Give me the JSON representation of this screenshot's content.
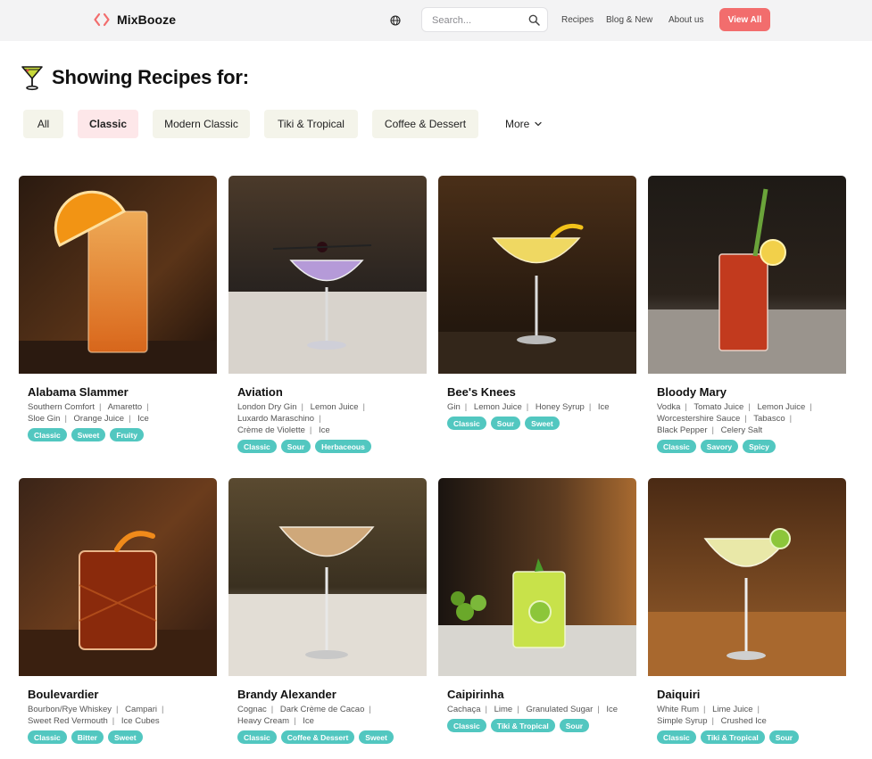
{
  "header": {
    "brand": "MixBooze",
    "search_placeholder": "Search...",
    "nav": [
      "Recipes",
      "Blog & New",
      "About us"
    ],
    "cta": "View All",
    "accent_color": "#f26d6d"
  },
  "page_title": "Showing Recipes for:",
  "filters": [
    {
      "label": "All",
      "active": false
    },
    {
      "label": "Classic",
      "active": true
    },
    {
      "label": "Modern Classic",
      "active": false
    },
    {
      "label": "Tiki & Tropical",
      "active": false
    },
    {
      "label": "Coffee & Dessert",
      "active": false
    }
  ],
  "more_label": "More",
  "tag_color": "#52c7c0",
  "recipes": [
    {
      "name": "Alabama Slammer",
      "ingredients": [
        "Southern Comfort",
        "Amaretto",
        "Sloe Gin",
        "Orange Juice",
        "Ice"
      ],
      "tags": [
        "Classic",
        "Sweet",
        "Fruity"
      ]
    },
    {
      "name": "Aviation",
      "ingredients": [
        "London Dry Gin",
        "Lemon Juice",
        "Luxardo Maraschino",
        "Crème de Violette",
        "Ice"
      ],
      "tags": [
        "Classic",
        "Sour",
        "Herbaceous"
      ]
    },
    {
      "name": "Bee's Knees",
      "ingredients": [
        "Gin",
        "Lemon Juice",
        "Honey Syrup",
        "Ice"
      ],
      "tags": [
        "Classic",
        "Sour",
        "Sweet"
      ]
    },
    {
      "name": "Bloody Mary",
      "ingredients": [
        "Vodka",
        "Tomato Juice",
        "Lemon Juice",
        "Worcestershire Sauce",
        "Tabasco",
        "Black Pepper",
        "Celery Salt"
      ],
      "tags": [
        "Classic",
        "Savory",
        "Spicy"
      ]
    },
    {
      "name": "Boulevardier",
      "ingredients": [
        "Bourbon/Rye Whiskey",
        "Campari",
        "Sweet Red Vermouth",
        "Ice Cubes"
      ],
      "tags": [
        "Classic",
        "Bitter",
        "Sweet"
      ]
    },
    {
      "name": "Brandy Alexander",
      "ingredients": [
        "Cognac",
        "Dark Crème de Cacao",
        "Heavy Cream",
        "Ice"
      ],
      "tags": [
        "Classic",
        "Coffee & Dessert",
        "Sweet"
      ]
    },
    {
      "name": "Caipirinha",
      "ingredients": [
        "Cachaça",
        "Lime",
        "Granulated Sugar",
        "Ice"
      ],
      "tags": [
        "Classic",
        "Tiki & Tropical",
        "Sour"
      ]
    },
    {
      "name": "Daiquiri",
      "ingredients": [
        "White Rum",
        "Lime Juice",
        "Simple Syrup",
        "Crushed Ice"
      ],
      "tags": [
        "Classic",
        "Tiki & Tropical",
        "Sour"
      ]
    }
  ]
}
